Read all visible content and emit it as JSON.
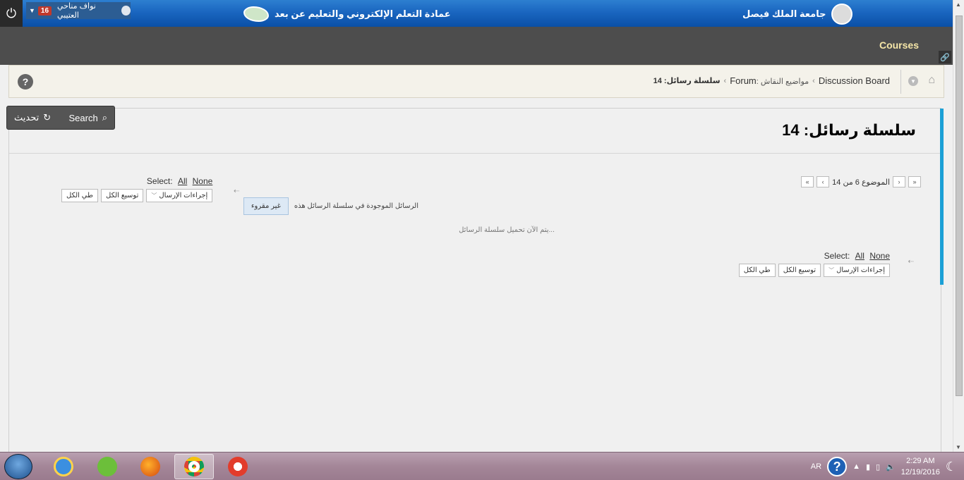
{
  "topbar": {
    "user_name": "نواف مناحي العتيبي",
    "notification_count": "16",
    "deanship_title": "عمادة التعلم الإلكتروني والتعليم عن بعد",
    "university_name": "جامعة الملك فيصل"
  },
  "nav": {
    "courses_tab": "Courses"
  },
  "breadcrumb": {
    "discussion_board": "Discussion Board",
    "forum_label": "Forum",
    "forum_topics": ": مواضيع النقاش",
    "current": "سلسلة رسائل: 14"
  },
  "tools": {
    "search_label": "Search",
    "refresh_label": "تحديث"
  },
  "page": {
    "title": "سلسلة رسائل: 14"
  },
  "pager": {
    "position_text": "الموضوع 6 من 14"
  },
  "thread": {
    "unread_text": "الرسائل الموجودة في سلسلة الرسائل هذه",
    "unread_button": "غير مقروء",
    "loading_text": "يتم الآن تحميل سلسلة الرسائل..."
  },
  "select": {
    "label": "Select:",
    "all": "All",
    "none": "None",
    "thread_actions": "إجراءات الإرسال",
    "expand_all": "توسيع الكل",
    "collapse_all": "طي الكل"
  },
  "taskbar": {
    "language": "AR",
    "time": "2:29 AM",
    "date": "12/19/2016"
  }
}
